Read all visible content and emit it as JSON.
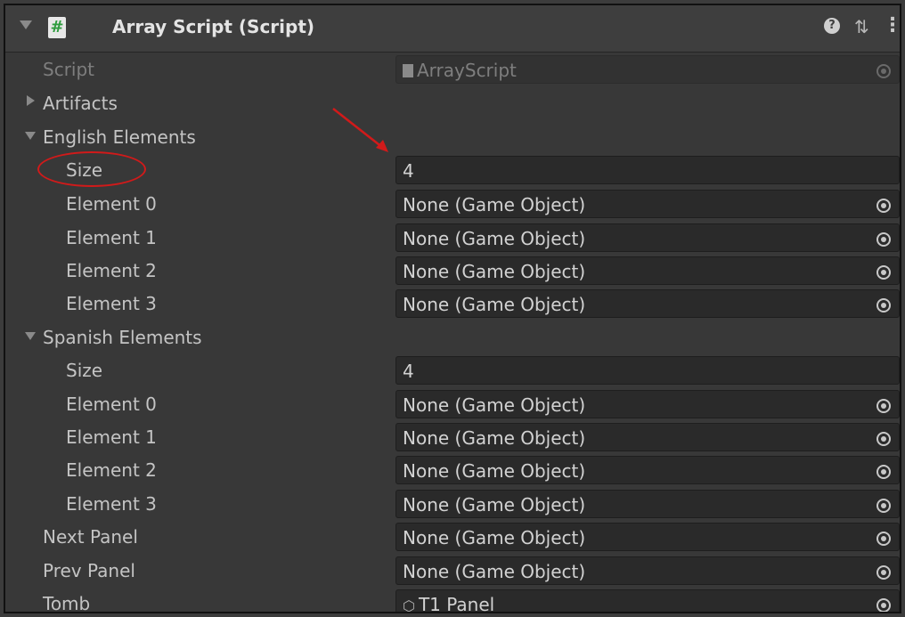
{
  "header": {
    "title": "Array Script (Script)",
    "script_icon_glyph": "#",
    "help_glyph": "?",
    "preset_glyph": "⇅",
    "menu_glyph": "⋮"
  },
  "script_row": {
    "label": "Script",
    "value": "ArrayScript"
  },
  "artifacts": {
    "label": "Artifacts"
  },
  "english": {
    "label": "English Elements",
    "size_label": "Size",
    "size_value": "4",
    "elements": [
      {
        "label": "Element 0",
        "value": "None (Game Object)"
      },
      {
        "label": "Element 1",
        "value": "None (Game Object)"
      },
      {
        "label": "Element 2",
        "value": "None (Game Object)"
      },
      {
        "label": "Element 3",
        "value": "None (Game Object)"
      }
    ]
  },
  "spanish": {
    "label": "Spanish Elements",
    "size_label": "Size",
    "size_value": "4",
    "elements": [
      {
        "label": "Element 0",
        "value": "None (Game Object)"
      },
      {
        "label": "Element 1",
        "value": "None (Game Object)"
      },
      {
        "label": "Element 2",
        "value": "None (Game Object)"
      },
      {
        "label": "Element 3",
        "value": "None (Game Object)"
      }
    ]
  },
  "next_panel": {
    "label": "Next Panel",
    "value": "None (Game Object)"
  },
  "prev_panel": {
    "label": "Prev Panel",
    "value": "None (Game Object)"
  },
  "tomb": {
    "label": "Tomb",
    "value": "T1 Panel"
  },
  "colors": {
    "annotation": "#d11a1a",
    "background": "#383838"
  }
}
